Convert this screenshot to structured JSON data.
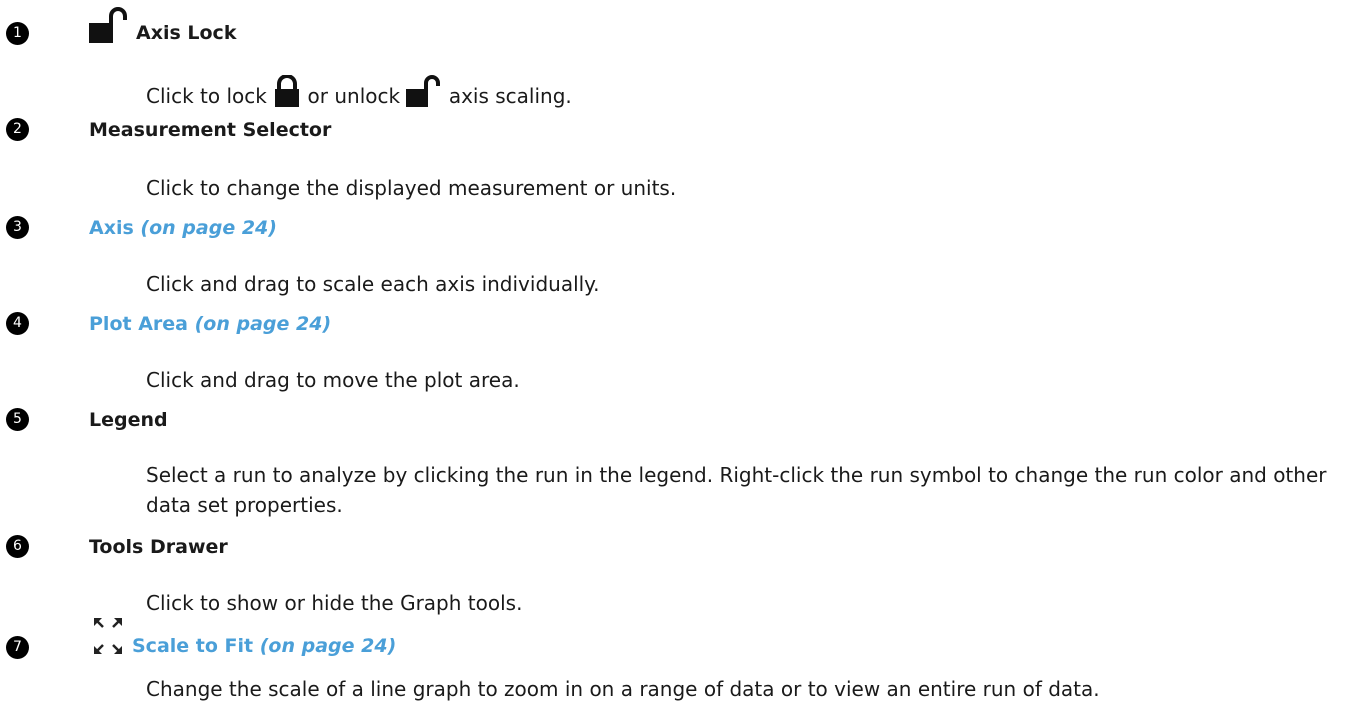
{
  "entries": [
    {
      "number": "1",
      "icon": "lock-open-icon",
      "title": "Axis Lock",
      "desc_before": "Click to lock",
      "desc_middle": "or unlock",
      "desc_after": "axis scaling."
    },
    {
      "number": "2",
      "title": "Measurement Selector",
      "desc": "Click to change the displayed measurement or units."
    },
    {
      "number": "3",
      "title": "Axis",
      "page_ref": "(on page 24)",
      "desc": "Click and drag to scale each axis individually."
    },
    {
      "number": "4",
      "title": "Plot Area",
      "page_ref": "(on page 24)",
      "desc": "Click and drag to move the plot area."
    },
    {
      "number": "5",
      "title": "Legend",
      "desc": "Select a run to analyze by clicking the run in the legend. Right-click the run symbol to change the run color and other data set properties."
    },
    {
      "number": "6",
      "title": "Tools Drawer",
      "desc": "Click to show or hide the Graph tools."
    },
    {
      "number": "7",
      "icon": "scale-to-fit-icon",
      "title": "Scale to Fit",
      "page_ref": "(on page 24)",
      "desc": "Change the scale of a line graph to zoom in on a range of data or to view an entire run of data."
    }
  ],
  "colors": {
    "link": "#4a9fd8",
    "badge": "#000000",
    "text": "#1a1a1a"
  }
}
